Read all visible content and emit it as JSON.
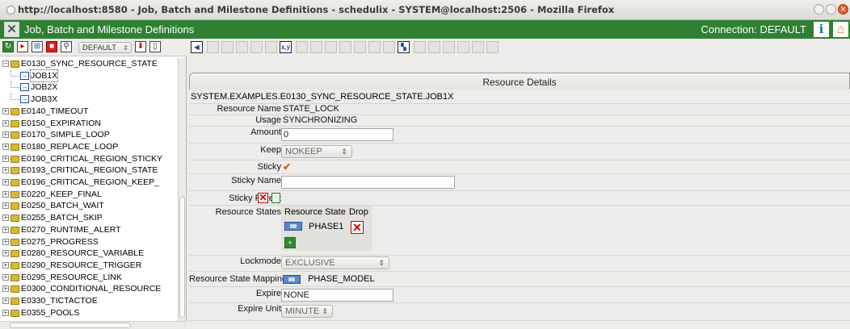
{
  "window": {
    "title": "http://localhost:8580 - Job, Batch and Milestone Definitions - schedulix - SYSTEM@localhost:2506 - Mozilla Firefox"
  },
  "app": {
    "title": "Job, Batch and Milestone Definitions",
    "connection": "Connection: DEFAULT",
    "accent": "#2f8033"
  },
  "left_toolbar": {
    "selector_value": "DEFAULT"
  },
  "tree": {
    "items": [
      {
        "label": "E0130_SYNC_RESOURCE_STATE",
        "kind": "folder",
        "depth": 0,
        "expanded": true
      },
      {
        "label": "JOB1X",
        "kind": "job",
        "depth": 1,
        "selected": true
      },
      {
        "label": "JOB2X",
        "kind": "job",
        "depth": 1
      },
      {
        "label": "JOB3X",
        "kind": "job",
        "depth": 1
      },
      {
        "label": "E0140_TIMEOUT",
        "kind": "folder",
        "depth": 0
      },
      {
        "label": "E0150_EXPIRATION",
        "kind": "folder",
        "depth": 0
      },
      {
        "label": "E0170_SIMPLE_LOOP",
        "kind": "folder",
        "depth": 0
      },
      {
        "label": "E0180_REPLACE_LOOP",
        "kind": "folder",
        "depth": 0
      },
      {
        "label": "E0190_CRITICAL_REGION_STICKY",
        "kind": "folder",
        "depth": 0
      },
      {
        "label": "E0193_CRITICAL_REGION_STATE",
        "kind": "folder",
        "depth": 0
      },
      {
        "label": "E0196_CRITICAL_REGION_KEEP_",
        "kind": "folder",
        "depth": 0
      },
      {
        "label": "E0220_KEEP_FINAL",
        "kind": "folder",
        "depth": 0
      },
      {
        "label": "E0250_BATCH_WAIT",
        "kind": "folder",
        "depth": 0
      },
      {
        "label": "E0255_BATCH_SKIP",
        "kind": "folder",
        "depth": 0
      },
      {
        "label": "E0270_RUNTIME_ALERT",
        "kind": "folder",
        "depth": 0
      },
      {
        "label": "E0275_PROGRESS",
        "kind": "folder",
        "depth": 0
      },
      {
        "label": "E0280_RESOURCE_VARIABLE",
        "kind": "folder",
        "depth": 0
      },
      {
        "label": "E0290_RESOURCE_TRIGGER",
        "kind": "folder",
        "depth": 0
      },
      {
        "label": "E0295_RESOURCE_LINK",
        "kind": "folder",
        "depth": 0
      },
      {
        "label": "E0300_CONDITIONAL_RESOURCE",
        "kind": "folder",
        "depth": 0
      },
      {
        "label": "E0330_TICTACTOE",
        "kind": "folder",
        "depth": 0
      },
      {
        "label": "E0355_POOLS",
        "kind": "folder",
        "depth": 0
      }
    ]
  },
  "details": {
    "section_title": "Resource Details",
    "path": "SYSTEM.EXAMPLES.E0130_SYNC_RESOURCE_STATE.JOB1X",
    "labels": {
      "resource_name": "Resource Name",
      "usage": "Usage",
      "amount": "Amount",
      "keep": "Keep",
      "sticky": "Sticky",
      "sticky_name": "Sticky Name",
      "sticky_parent": "Sticky Parent",
      "resource_states": "Resource States",
      "lockmode": "Lockmode",
      "rsm": "Resource State Mapping",
      "expire": "Expire",
      "expire_unit": "Expire Unit"
    },
    "resource_name": "STATE_LOCK",
    "usage": "SYNCHRONIZING",
    "amount": "0",
    "keep": "NOKEEP",
    "sticky_checked": true,
    "sticky_name": "",
    "resource_states_table": {
      "headers": [
        "Resource State",
        "Drop"
      ],
      "rows": [
        {
          "state": "PHASE1"
        }
      ]
    },
    "lockmode": "EXCLUSIVE",
    "rsm": "PHASE_MODEL",
    "expire": "NONE",
    "expire_unit": "MINUTE"
  }
}
